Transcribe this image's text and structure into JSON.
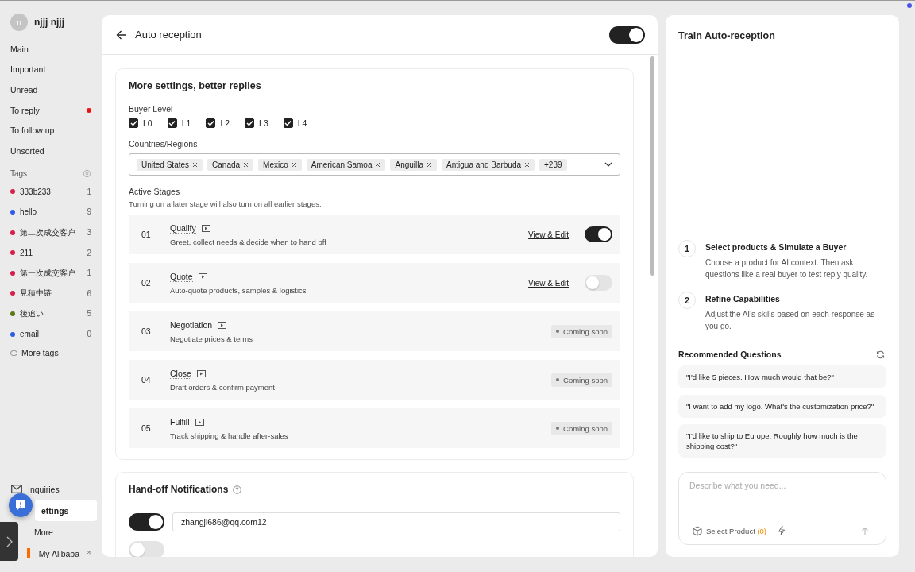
{
  "sidebar": {
    "user": {
      "initial": "n",
      "name": "njjj njjj"
    },
    "nav": [
      {
        "label": "Main",
        "dot": false
      },
      {
        "label": "Important",
        "dot": false
      },
      {
        "label": "Unread",
        "dot": false
      },
      {
        "label": "To reply",
        "dot": true
      },
      {
        "label": "To follow up",
        "dot": false
      },
      {
        "label": "Unsorted",
        "dot": false
      }
    ],
    "tags_heading": "Tags",
    "tags": [
      {
        "name": "333b233",
        "count": "1",
        "color": "#d81e4a"
      },
      {
        "name": "hello",
        "count": "9",
        "color": "#2f5bea"
      },
      {
        "name": "第二次成交客户",
        "count": "3",
        "color": "#d81e4a"
      },
      {
        "name": "211",
        "count": "2",
        "color": "#d81e4a"
      },
      {
        "name": "第一次成交客户",
        "count": "1",
        "color": "#d81e4a"
      },
      {
        "name": "見積中链",
        "count": "6",
        "color": "#d81e4a"
      },
      {
        "name": "後追い",
        "count": "5",
        "color": "#5a7a12"
      },
      {
        "name": "email",
        "count": "0",
        "color": "#2f5bea"
      }
    ],
    "more_tags": "More tags",
    "bottom": [
      {
        "label": "Inquiries",
        "kind": "mail",
        "selected": false
      },
      {
        "label": "ettings",
        "kind": "settings",
        "selected": true
      },
      {
        "label": "More",
        "kind": "more",
        "selected": false
      },
      {
        "label": "My Alibaba",
        "kind": "alibaba",
        "selected": false
      }
    ]
  },
  "main": {
    "title": "Auto reception",
    "enabled": true,
    "settings": {
      "title": "More settings, better replies",
      "buyer_level_label": "Buyer Level",
      "levels": [
        {
          "label": "L0",
          "checked": true
        },
        {
          "label": "L1",
          "checked": true
        },
        {
          "label": "L2",
          "checked": true
        },
        {
          "label": "L3",
          "checked": true
        },
        {
          "label": "L4",
          "checked": true
        }
      ],
      "countries_label": "Countries/Regions",
      "countries": [
        "United States",
        "Canada",
        "Mexico",
        "American Samoa",
        "Anguilla",
        "Antigua and Barbuda"
      ],
      "more_count": "+239",
      "stages_label": "Active Stages",
      "stages_hint": "Turning on a later stage will also turn on all earlier stages.",
      "stages": [
        {
          "number": "01",
          "name": "Qualify",
          "description": "Greet, collect needs & decide when to hand off",
          "kind": "toggle",
          "link": "View & Edit",
          "on": true
        },
        {
          "number": "02",
          "name": "Quote",
          "description": "Auto-quote products, samples & logistics",
          "kind": "toggle",
          "link": "View & Edit",
          "on": false
        },
        {
          "number": "03",
          "name": "Negotiation",
          "description": "Negotiate prices & terms",
          "kind": "coming_soon",
          "badge": "Coming soon"
        },
        {
          "number": "04",
          "name": "Close",
          "description": "Draft orders & confirm payment",
          "kind": "coming_soon",
          "badge": "Coming soon"
        },
        {
          "number": "05",
          "name": "Fulfill",
          "description": "Track shipping & handle after-sales",
          "kind": "coming_soon",
          "badge": "Coming soon"
        }
      ]
    },
    "notifications": {
      "title": "Hand-off Notifications",
      "rows": [
        {
          "on": true,
          "value": "zhangjl686@qq.com12"
        },
        {
          "on": false
        }
      ]
    }
  },
  "right": {
    "title": "Train Auto-reception",
    "steps": [
      {
        "number": "1",
        "title": "Select products & Simulate a Buyer",
        "text": "Choose a product for AI context. Then ask questions like a real buyer to test reply quality."
      },
      {
        "number": "2",
        "title": "Refine Capabilities",
        "text": "Adjust the AI's skills based on each response as you go."
      }
    ],
    "recommended_title": "Recommended Questions",
    "questions": [
      "\"I'd like 5 pieces. How much would that be?\"",
      "\"I want to add my logo. What's the customization price?\"",
      "\"I'd like to ship to Europe. Roughly how much is the shipping cost?\""
    ],
    "composer": {
      "placeholder": "Describe what you need...",
      "select_product": "Select Product",
      "count": "(0)"
    }
  }
}
